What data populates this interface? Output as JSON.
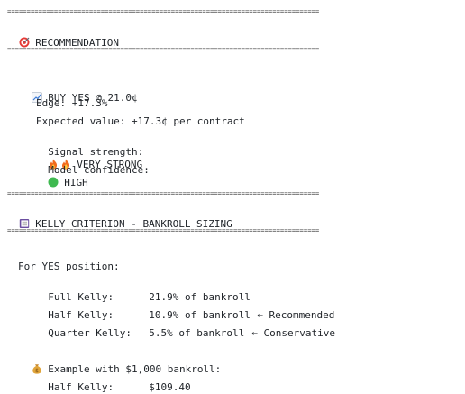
{
  "rule": "================================================================================",
  "recommendation": {
    "heading": "RECOMMENDATION",
    "heading_icon": "target-icon",
    "action": "BUY YES @ 21.0¢",
    "action_icon": "chart-up-icon",
    "edge": "Edge: +17.3%",
    "expected_value": "Expected value: +17.3¢ per contract",
    "signal_label": "Signal strength:",
    "signal_icons": [
      "fire-icon",
      "fire-icon"
    ],
    "signal_value": "VERY STRONG",
    "confidence_label": "Model confidence:",
    "confidence_icon": "green-circle-icon",
    "confidence_value": "HIGH"
  },
  "kelly": {
    "heading": "KELLY CRITERION - BANKROLL SIZING",
    "heading_icon": "notebook-icon",
    "position_label": "For YES position:",
    "rows": [
      {
        "label": "Full Kelly:",
        "value": "21.9% of bankroll",
        "note": ""
      },
      {
        "label": "Half Kelly:",
        "value": "10.9% of bankroll",
        "note": "← Recommended"
      },
      {
        "label": "Quarter Kelly:",
        "value": "5.5% of bankroll",
        "note": "← Conservative"
      }
    ],
    "example_icon": "money-bag-icon",
    "example_label": "Example with $1,000 bankroll:",
    "example_rows": [
      {
        "label": "Half Kelly:",
        "value": "$109.40"
      }
    ]
  },
  "colors": {
    "text": "#1f2328",
    "fire": "#f26b1d",
    "green_dot": "#3fb950"
  }
}
